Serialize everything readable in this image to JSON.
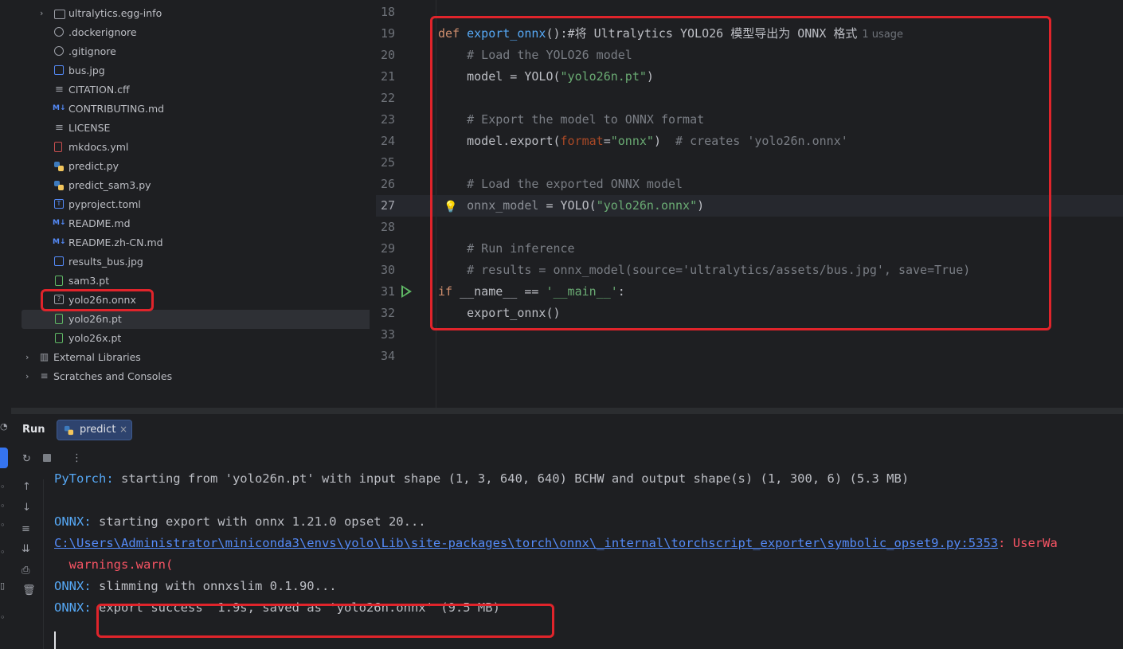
{
  "project_tree": {
    "items": [
      {
        "label": "ultralytics.egg-info",
        "icon": "folder-icon",
        "expand": "›"
      },
      {
        "label": ".dockerignore",
        "icon": "ignore-file-icon"
      },
      {
        "label": ".gitignore",
        "icon": "ignore-file-icon"
      },
      {
        "label": "bus.jpg",
        "icon": "image-file-icon"
      },
      {
        "label": "CITATION.cff",
        "icon": "text-file-icon"
      },
      {
        "label": "CONTRIBUTING.md",
        "icon": "markdown-file-icon"
      },
      {
        "label": "LICENSE",
        "icon": "text-file-icon"
      },
      {
        "label": "mkdocs.yml",
        "icon": "yaml-file-icon"
      },
      {
        "label": "predict.py",
        "icon": "python-file-icon"
      },
      {
        "label": "predict_sam3.py",
        "icon": "python-file-icon"
      },
      {
        "label": "pyproject.toml",
        "icon": "toml-file-icon"
      },
      {
        "label": "README.md",
        "icon": "markdown-file-icon"
      },
      {
        "label": "README.zh-CN.md",
        "icon": "markdown-file-icon"
      },
      {
        "label": "results_bus.jpg",
        "icon": "image-file-icon"
      },
      {
        "label": "sam3.pt",
        "icon": "binary-file-icon"
      },
      {
        "label": "yolo26n.onnx",
        "icon": "unknown-file-icon"
      },
      {
        "label": "yolo26n.pt",
        "icon": "binary-file-icon"
      },
      {
        "label": "yolo26x.pt",
        "icon": "binary-file-icon"
      }
    ],
    "external_libraries": "External Libraries",
    "scratches": "Scratches and Consoles"
  },
  "editor": {
    "line_numbers": [
      "18",
      "19",
      "20",
      "21",
      "22",
      "23",
      "24",
      "25",
      "26",
      "27",
      "28",
      "29",
      "30",
      "31",
      "32",
      "33",
      "34"
    ],
    "current_line": "27",
    "lines": {
      "l19_kw": "def",
      "l19_fn": "export_onnx",
      "l19_rest": "():#将 Ultralytics YOLO26 模型导出为 ONNX 格式",
      "l19_hint": "1 usage",
      "l20": "    # Load the YOLO26 model",
      "l21_a": "    model = YOLO(",
      "l21_str": "\"yolo26n.pt\"",
      "l21_b": ")",
      "l23": "    # Export the model to ONNX format",
      "l24_a": "    model.export(",
      "l24_param": "format",
      "l24_eq": "=",
      "l24_str": "\"onnx\"",
      "l24_b": ")  ",
      "l24_cm": "# creates 'yolo26n.onnx'",
      "l26": "    # Load the exported ONNX model",
      "l27_a": "    onnx_model",
      "l27_b": " = YOLO(",
      "l27_str": "\"yolo26n.onnx\"",
      "l27_c": ")",
      "l29": "    # Run inference",
      "l30": "    # results = onnx_model(source='ultralytics/assets/bus.jpg', save=True)",
      "l31_kw": "if",
      "l31_a": " __name__ == ",
      "l31_str": "'__main__'",
      "l31_b": ":",
      "l32": "    export_onnx()"
    }
  },
  "run_panel": {
    "title": "Run",
    "tab_label": "predict",
    "tab_close": "×",
    "console": {
      "l1_prefix": "PyTorch:",
      "l1_text": " starting from 'yolo26n.pt' with input shape (1, 3, 640, 640) BCHW and output shape(s) (1, 300, 6) (5.3 MB)",
      "l2_prefix": "ONNX:",
      "l2_text": " starting export with onnx 1.21.0 opset 20...",
      "l3_link": "C:\\Users\\Administrator\\miniconda3\\envs\\yolo\\Lib\\site-packages\\torch\\onnx\\_internal\\torchscript_exporter\\symbolic_opset9.py:5353",
      "l3_err": ": UserWa",
      "l4_err": "  warnings.warn(",
      "l5_prefix": "ONNX:",
      "l5_text": " slimming with onnxslim 0.1.90...",
      "l6_prefix": "ONNX:",
      "l6_text": " export success  1.9s, saved as 'yolo26n.onnx' (9.5 MB)"
    }
  },
  "colors": {
    "annotation": "#e0242b",
    "accent": "#3574f0",
    "keyword": "#cf8e6d",
    "string": "#6aab73",
    "comment": "#7a7e85"
  }
}
